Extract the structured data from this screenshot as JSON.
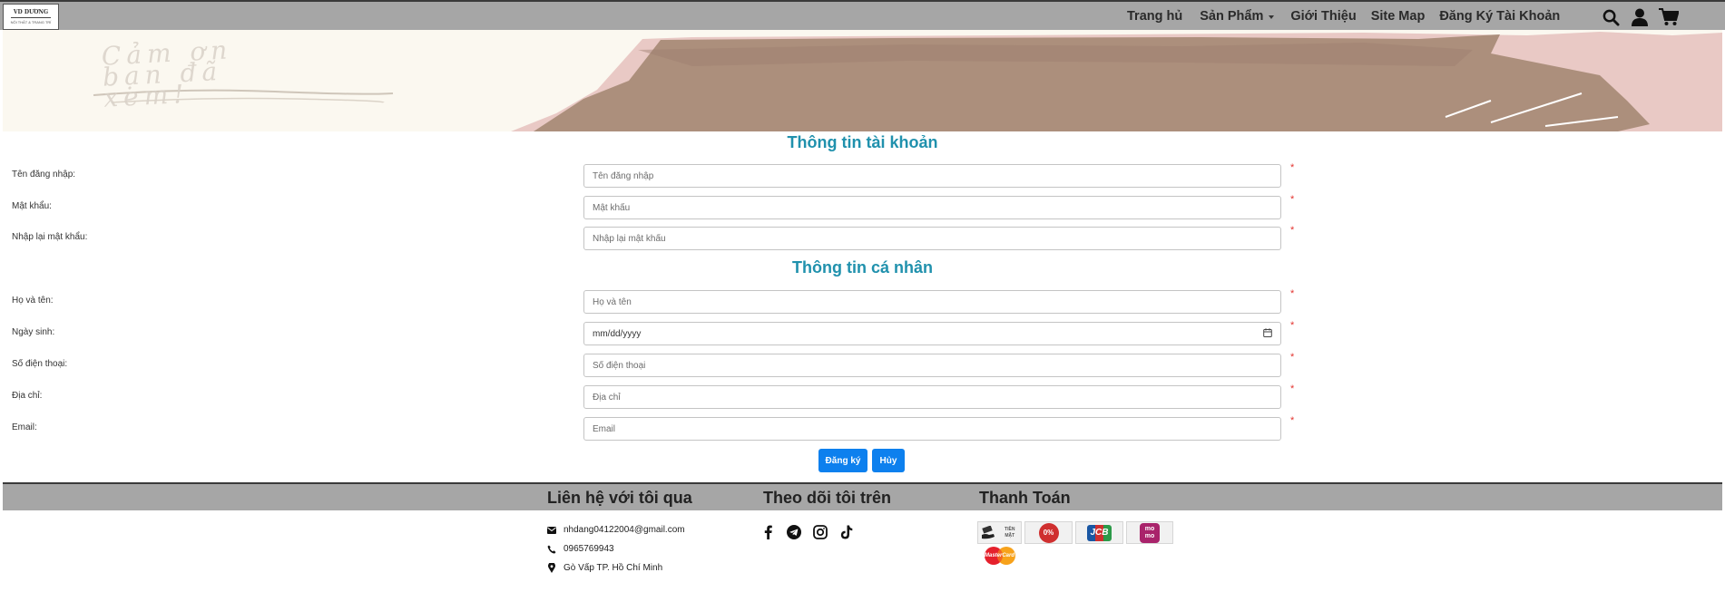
{
  "header": {
    "logo_text": "VD DƯƠNG",
    "logo_sub": "NỘI THẤT & TRANG TRÍ",
    "nav": {
      "home": "Trang hủ",
      "products": "Sản Phẩm",
      "about": "Giới Thiệu",
      "sitemap": "Site Map",
      "register": "Đăng Ký Tài Khoản"
    },
    "icons": [
      "search-icon",
      "user-icon",
      "cart-icon"
    ]
  },
  "banner": {
    "script_text": "Cảm ơn\nbạn đã\nxem!"
  },
  "form": {
    "account_title": "Thông tin tài khoản",
    "personal_title": "Thông tin cá nhân",
    "fields": {
      "username": {
        "label": "Tên đăng nhập:",
        "placeholder": "Tên đăng nhập"
      },
      "password": {
        "label": "Mật khẩu:",
        "placeholder": "Mật khẩu"
      },
      "confirm": {
        "label": "Nhập lại mật khẩu:",
        "placeholder": "Nhập lại mật khẩu"
      },
      "fullname": {
        "label": "Họ và tên:",
        "placeholder": "Họ và tên"
      },
      "dob": {
        "label": "Ngày sinh:",
        "placeholder": "mm/dd/yyyy"
      },
      "phone": {
        "label": "Số điện thoại:",
        "placeholder": "Số điện thoại"
      },
      "address": {
        "label": "Địa chỉ:",
        "placeholder": "Địa chỉ"
      },
      "email": {
        "label": "Email:",
        "placeholder": "Email"
      }
    },
    "required_mark": "*",
    "register_button": "Đăng ký",
    "cancel_button": "Hủy"
  },
  "footer": {
    "contact_title": "Liên hệ với tôi qua",
    "follow_title": "Theo dõi tôi trên",
    "payment_title": "Thanh Toán",
    "email": "nhdang04122004@gmail.com",
    "phone": "0965769943",
    "address": "Gò Vấp TP. Hồ Chí Minh",
    "payments": {
      "cash": "TIỀN MẶT",
      "installment": "0%",
      "jcb": "JCB",
      "momo": "mo mo",
      "mastercard": "MasterCard"
    }
  },
  "colors": {
    "nav_bg": "#a6a6a6",
    "title": "#2091ad",
    "button": "#0d80ee",
    "required": "#e3342f"
  }
}
